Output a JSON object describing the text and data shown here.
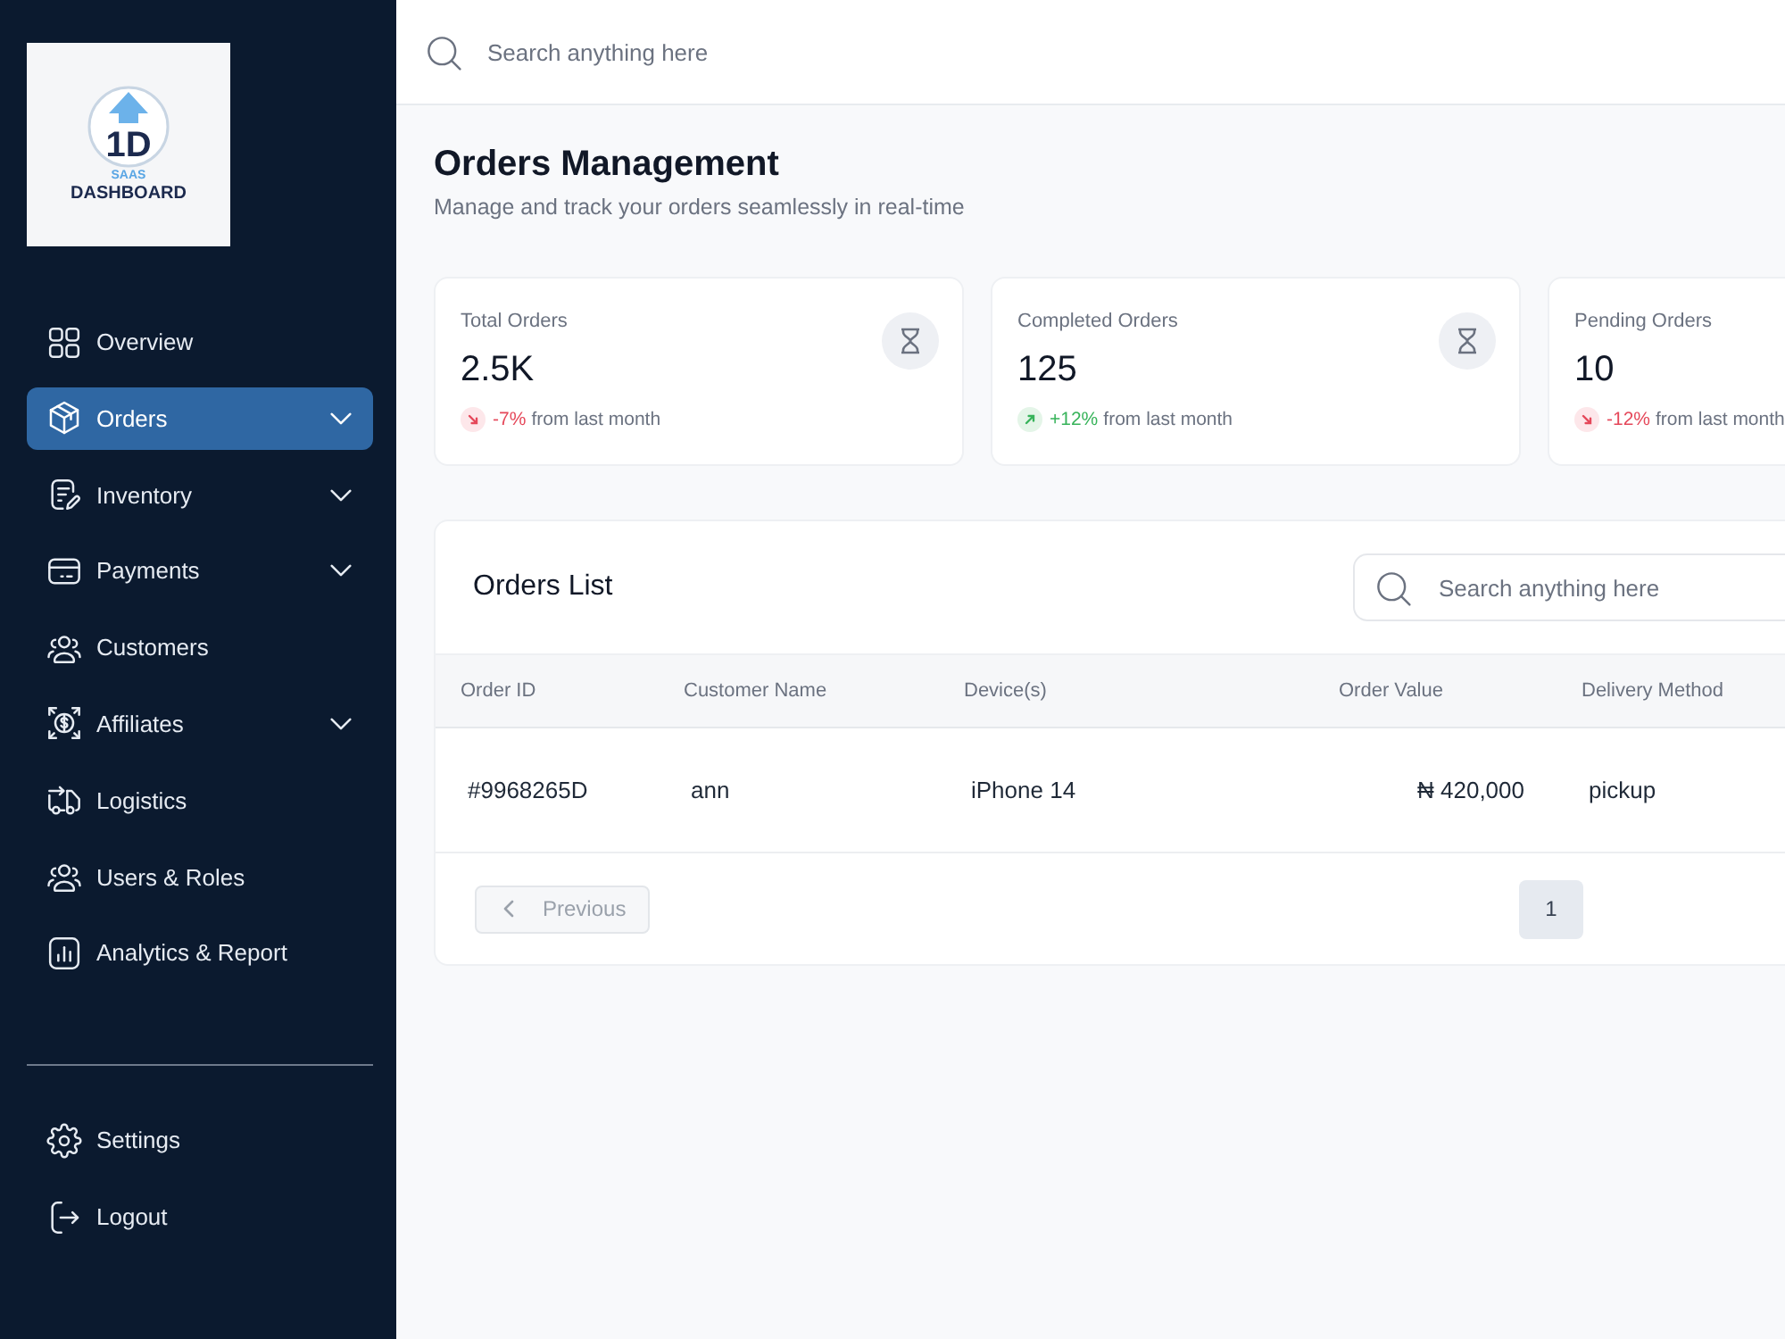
{
  "sidebar": {
    "logo": {
      "mark": "1D",
      "tagline": "SAAS",
      "name": "DASHBOARD"
    },
    "nav": [
      {
        "label": "Overview",
        "selected": false,
        "has_submenu": false
      },
      {
        "label": "Orders",
        "selected": true,
        "has_submenu": true
      },
      {
        "label": "Inventory",
        "selected": false,
        "has_submenu": true
      },
      {
        "label": "Payments",
        "selected": false,
        "has_submenu": true
      },
      {
        "label": "Customers",
        "selected": false,
        "has_submenu": false
      },
      {
        "label": "Affiliates",
        "selected": false,
        "has_submenu": true
      },
      {
        "label": "Logistics",
        "selected": false,
        "has_submenu": false
      },
      {
        "label": "Users & Roles",
        "selected": false,
        "has_submenu": false
      },
      {
        "label": "Analytics & Report",
        "selected": false,
        "has_submenu": false
      }
    ],
    "footer_nav": [
      {
        "label": "Settings"
      },
      {
        "label": "Logout"
      }
    ]
  },
  "top_bar": {
    "search": {
      "placeholder": "Search anything here"
    }
  },
  "header": {
    "title": "Orders Management",
    "subtitle": "Manage and track your orders seamlessly in real-time"
  },
  "stats": [
    {
      "label": "Total Orders",
      "value": "2.5K",
      "kind": "decrease",
      "change": "-7%",
      "note": "from last month",
      "icon": true
    },
    {
      "label": "Completed Orders",
      "value": "125",
      "kind": "increase",
      "change": "+12%",
      "note": "from last month",
      "icon": true
    },
    {
      "label": "Pending Orders",
      "value": "10",
      "kind": "decrease",
      "change": "-12%",
      "note": "from last month"
    }
  ],
  "orders_list": {
    "title": "Orders List",
    "search": {
      "placeholder": "Search anything here"
    },
    "table": {
      "columns": [
        "Order ID",
        "Customer Name",
        "Device(s)",
        "Order Value",
        "Delivery Method"
      ],
      "rows": [
        {
          "cells": [
            "#9968265D",
            "ann",
            "iPhone 14",
            "₦ 420,000",
            "pickup"
          ]
        }
      ]
    },
    "pagination": {
      "previous": {
        "label": "Previous",
        "disabled": true
      },
      "pages": [
        {
          "label": "1",
          "selected": true
        }
      ]
    }
  }
}
